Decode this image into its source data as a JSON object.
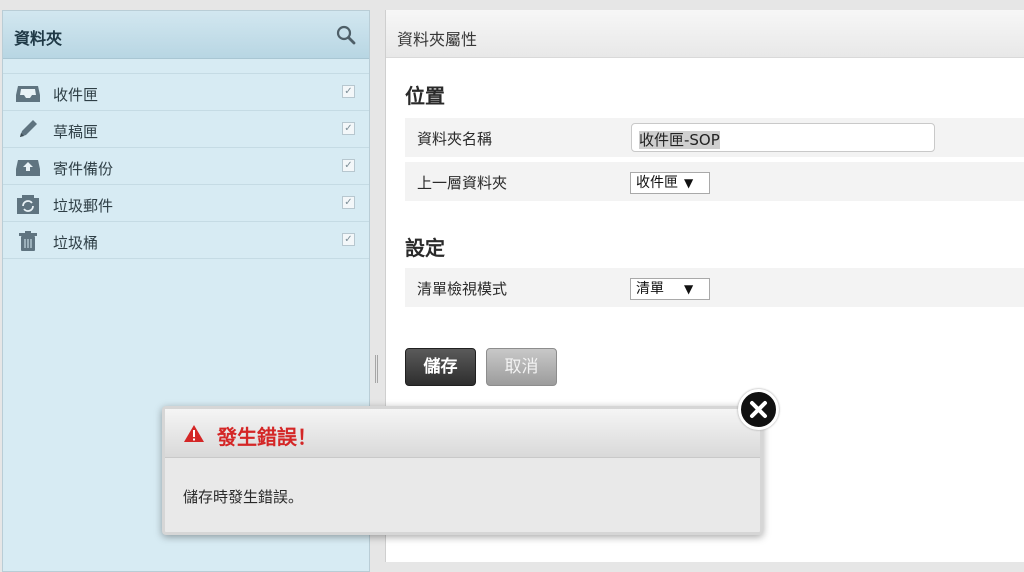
{
  "sidebar": {
    "title": "資料夾",
    "items": [
      {
        "label": "收件匣",
        "icon": "inbox-icon",
        "checked": true
      },
      {
        "label": "草稿匣",
        "icon": "pencil-icon",
        "checked": true
      },
      {
        "label": "寄件備份",
        "icon": "sent-icon",
        "checked": true
      },
      {
        "label": "垃圾郵件",
        "icon": "junk-icon",
        "checked": true
      },
      {
        "label": "垃圾桶",
        "icon": "trash-icon",
        "checked": true
      }
    ]
  },
  "main": {
    "title": "資料夾屬性",
    "location_section": "位置",
    "settings_section": "設定",
    "folder_name_label": "上一層資料夾",
    "parent_folder_label": "上一層資料夾",
    "folder_name_value": "收件匣-SOP",
    "parent_folder_value": "收件匣",
    "list_view_label": "清單檢視模式",
    "list_view_value": "清單",
    "save_label": "儲存",
    "cancel_label": "取消"
  },
  "dialog": {
    "title": "發生錯誤！",
    "message": "儲存時發生錯誤。"
  }
}
